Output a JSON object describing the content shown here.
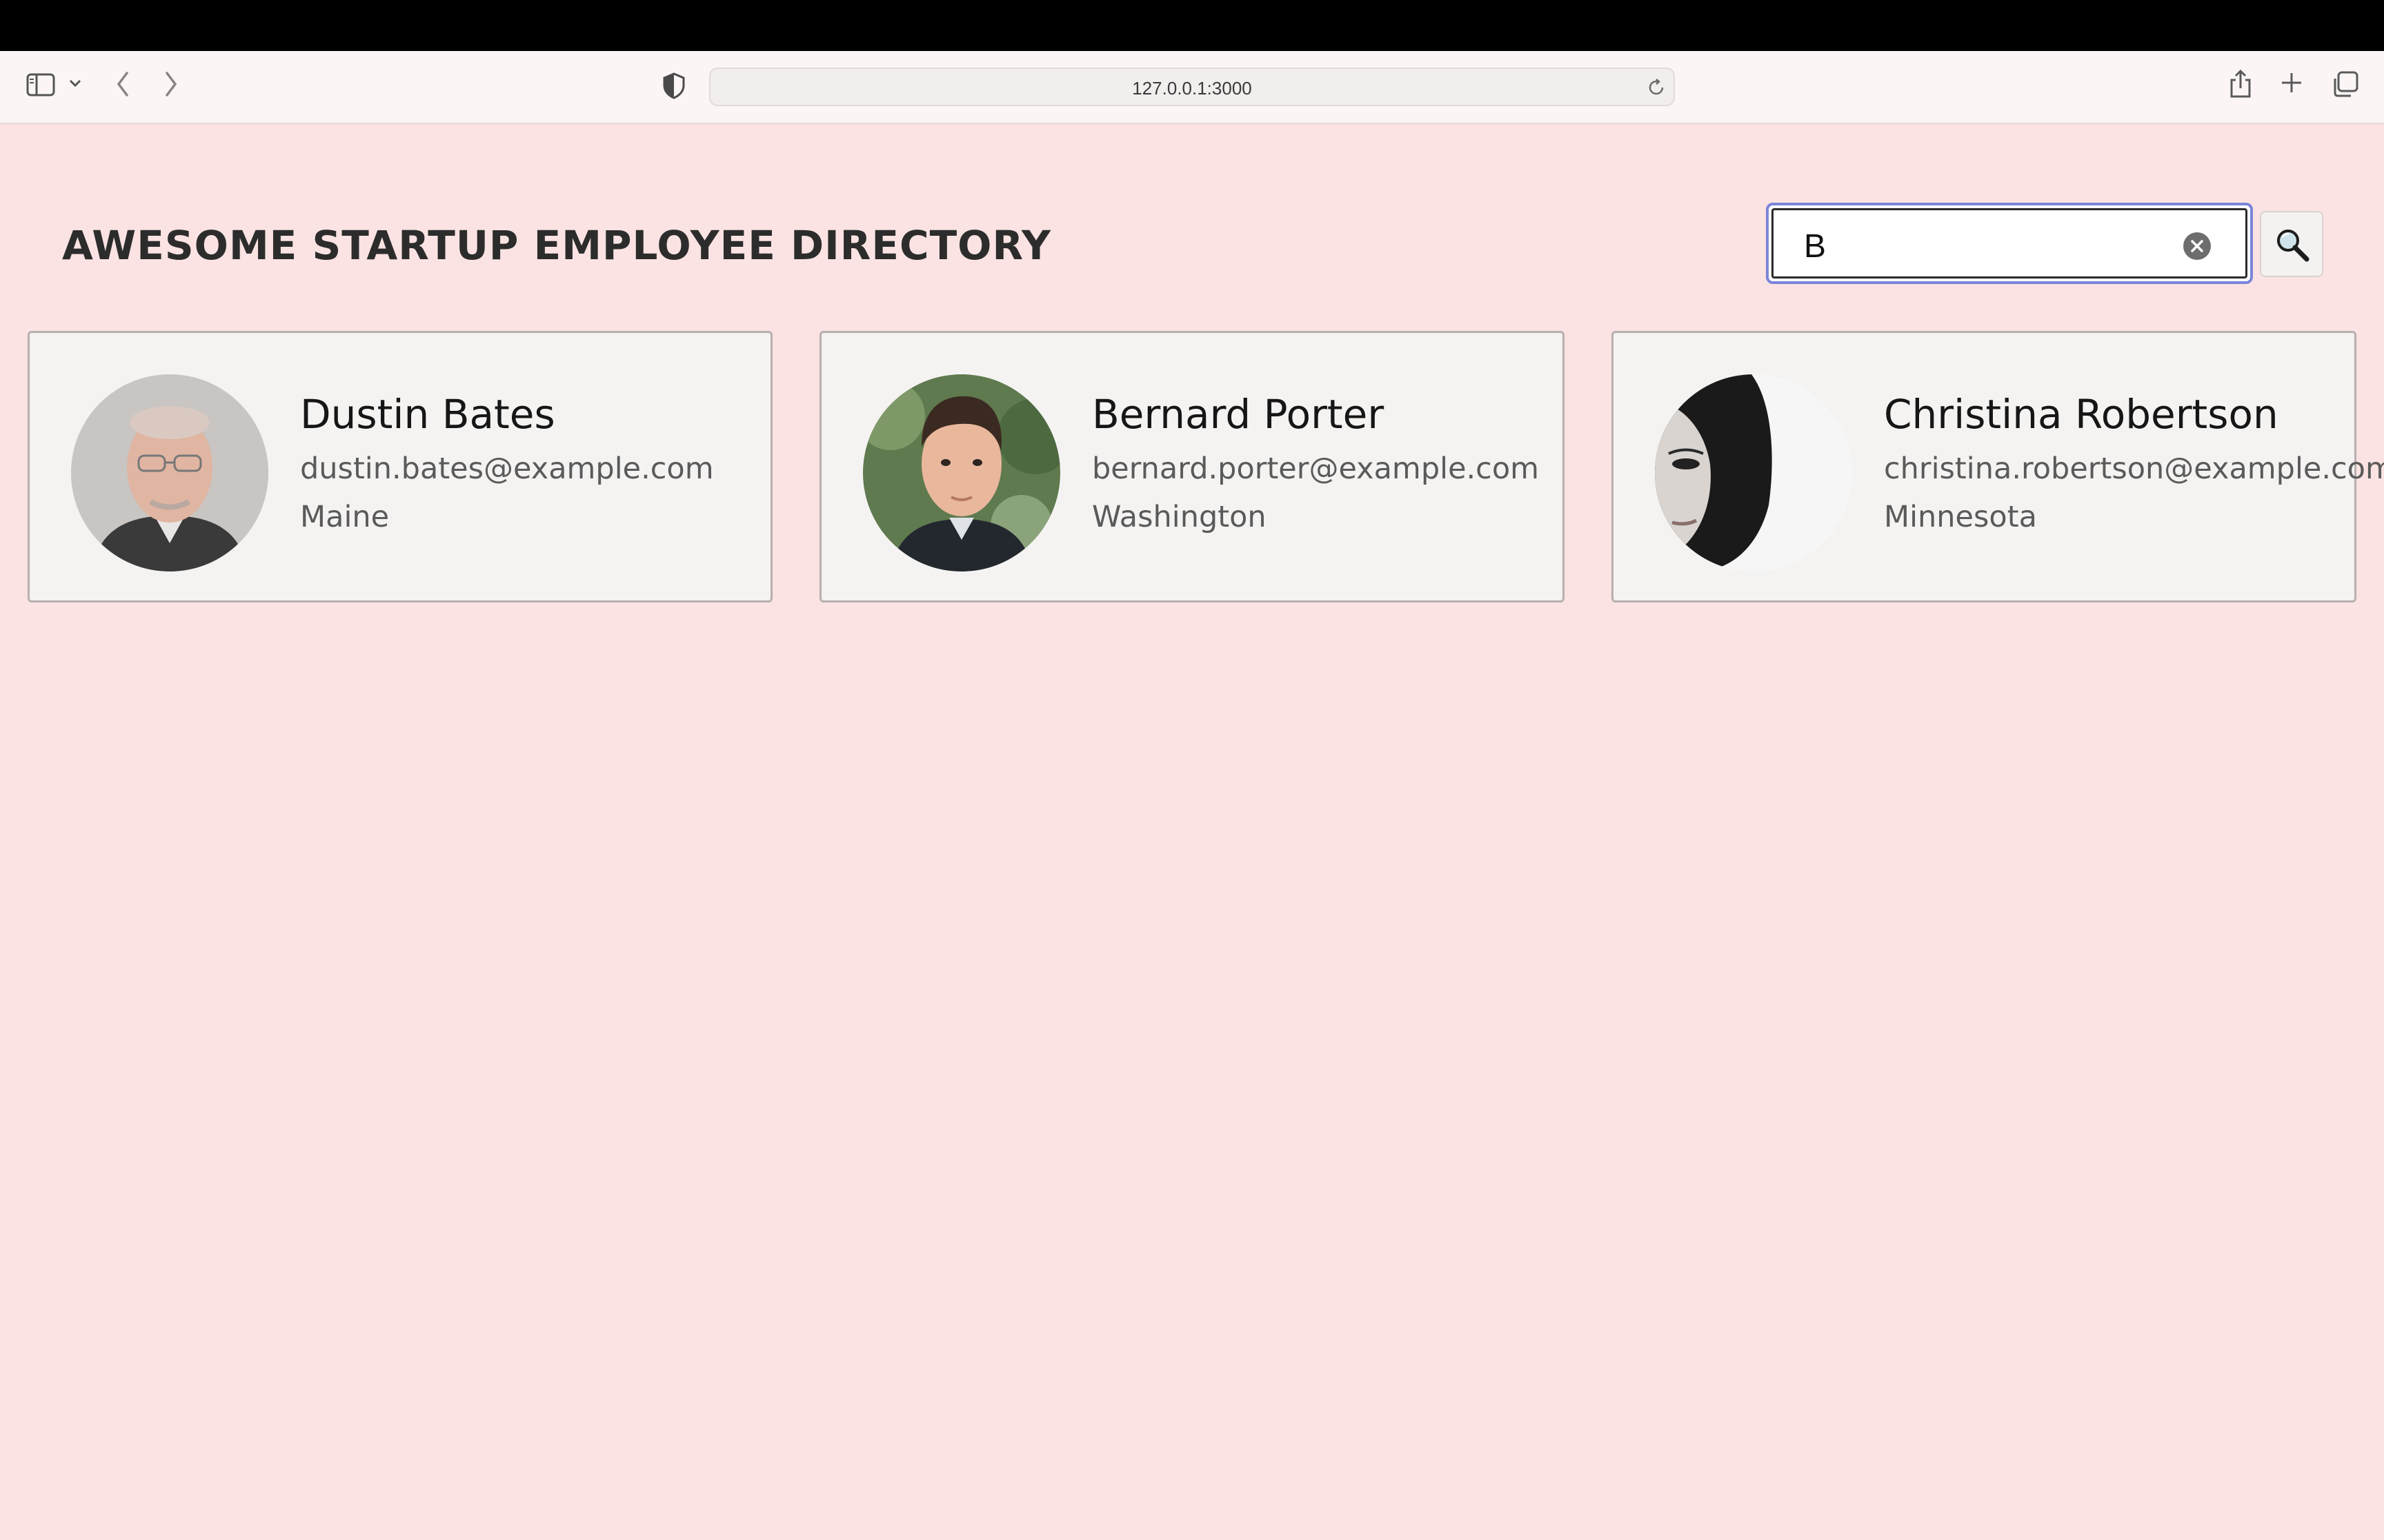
{
  "browser": {
    "url": "127.0.0.1:3000",
    "icons": [
      "sidebar-icon",
      "chevron-down-icon",
      "back-arrow-icon",
      "forward-arrow-icon",
      "shield-icon",
      "reload-icon",
      "share-icon",
      "new-tab-icon",
      "tabs-overview-icon"
    ]
  },
  "header": {
    "title": "AWESOME STARTUP EMPLOYEE DIRECTORY"
  },
  "search": {
    "value": "B",
    "accent_color": "#7b85d9"
  },
  "employees": [
    {
      "name": "Dustin Bates",
      "email": "dustin.bates@example.com",
      "state": "Maine"
    },
    {
      "name": "Bernard Porter",
      "email": "bernard.porter@example.com",
      "state": "Washington"
    },
    {
      "name": "Christina Robertson",
      "email": "christina.robertson@example.com",
      "state": "Minnesota"
    }
  ],
  "colors": {
    "page_background": "#fae3e2",
    "card_background": "#f5f3f2"
  }
}
